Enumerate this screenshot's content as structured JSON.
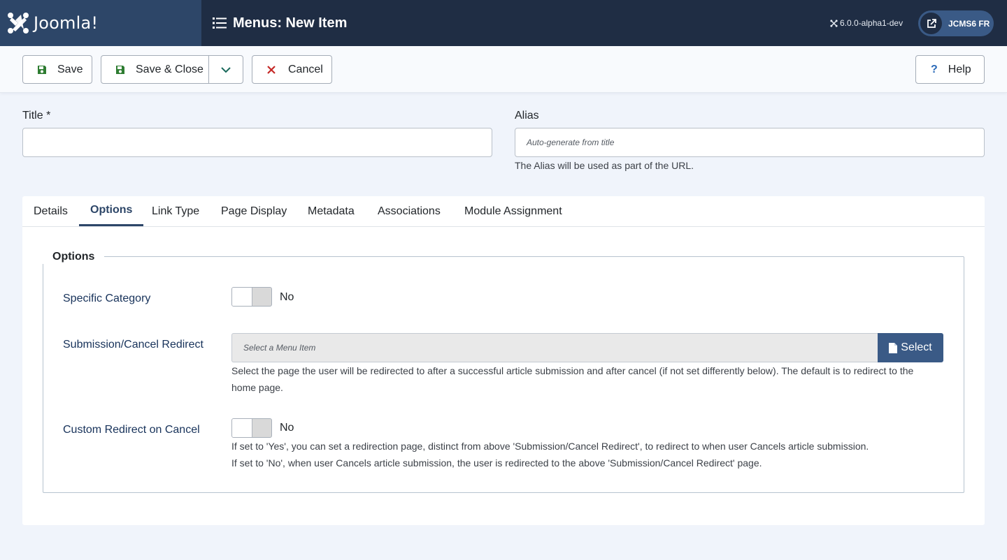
{
  "header": {
    "logo_text": "Joomla!",
    "page_title": "Menus: New Item",
    "version": "6.0.0-alpha1-dev",
    "site_button": "JCMS6 FR"
  },
  "toolbar": {
    "save_label": "Save",
    "save_close_label": "Save & Close",
    "cancel_label": "Cancel",
    "help_label": "Help"
  },
  "form": {
    "title_label": "Title *",
    "title_value": "",
    "alias_label": "Alias",
    "alias_placeholder": "Auto-generate from title",
    "alias_hint": "The Alias will be used as part of the URL."
  },
  "tabs": [
    {
      "label": "Details",
      "active": false
    },
    {
      "label": "Options",
      "active": true
    },
    {
      "label": "Link Type",
      "active": false
    },
    {
      "label": "Page Display",
      "active": false
    },
    {
      "label": "Metadata",
      "active": false
    },
    {
      "label": "Associations",
      "active": false
    },
    {
      "label": "Module Assignment",
      "active": false
    }
  ],
  "options": {
    "legend": "Options",
    "specific_category": {
      "label": "Specific Category",
      "value": "No"
    },
    "redirect": {
      "label": "Submission/Cancel Redirect",
      "placeholder": "Select a Menu Item",
      "button": "Select",
      "description": "Select the page the user will be redirected to after a successful article submission and after cancel (if not set differently below). The default is to redirect to the home page."
    },
    "custom_redirect": {
      "label": "Custom Redirect on Cancel",
      "value": "No",
      "description_1": "If set to 'Yes', you can set a redirection page, distinct from above 'Submission/Cancel Redirect', to redirect to when user Cancels article submission.",
      "description_2": "If set to 'No', when user Cancels article submission, the user is redirected to the above 'Submission/Cancel Redirect' page."
    }
  },
  "colors": {
    "header_bg": "#1f2d44",
    "logo_bg": "#2d4668",
    "accent": "#3a5a86",
    "save_icon": "#2f7d32",
    "cancel_icon": "#c52827"
  },
  "icons": [
    "joomla-logo-icon",
    "list-icon",
    "joomla-small-icon",
    "external-link-icon",
    "save-icon",
    "chevron-down-icon",
    "close-icon",
    "help-icon",
    "file-icon"
  ]
}
